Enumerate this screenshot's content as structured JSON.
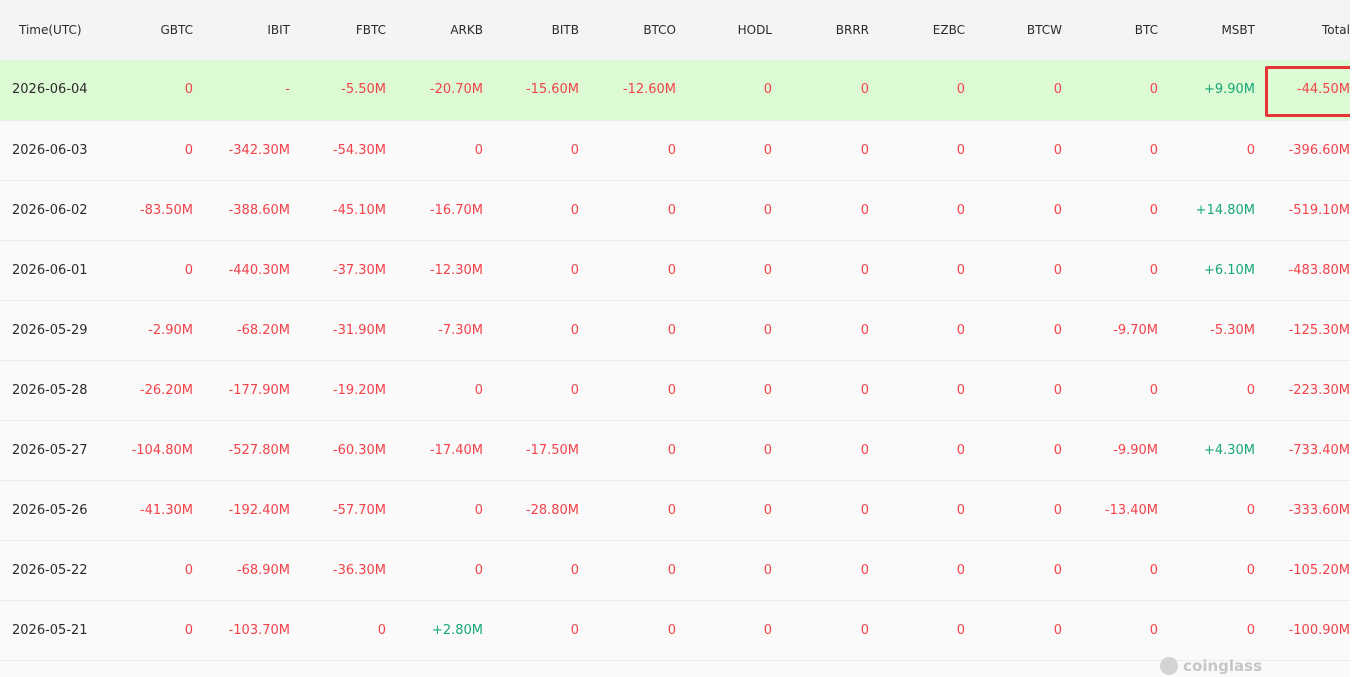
{
  "columns": [
    "Time(UTC)",
    "GBTC",
    "IBIT",
    "FBTC",
    "ARKB",
    "BITB",
    "BTCO",
    "HODL",
    "BRRR",
    "EZBC",
    "BTCW",
    "BTC",
    "MSBT",
    "Total"
  ],
  "rows": [
    [
      "2026-06-04",
      "0",
      "-",
      "-5.50M",
      "-20.70M",
      "-15.60M",
      "-12.60M",
      "0",
      "0",
      "0",
      "0",
      "0",
      "+9.90M",
      "-44.50M"
    ],
    [
      "2026-06-03",
      "0",
      "-342.30M",
      "-54.30M",
      "0",
      "0",
      "0",
      "0",
      "0",
      "0",
      "0",
      "0",
      "0",
      "-396.60M"
    ],
    [
      "2026-06-02",
      "-83.50M",
      "-388.60M",
      "-45.10M",
      "-16.70M",
      "0",
      "0",
      "0",
      "0",
      "0",
      "0",
      "0",
      "+14.80M",
      "-519.10M"
    ],
    [
      "2026-06-01",
      "0",
      "-440.30M",
      "-37.30M",
      "-12.30M",
      "0",
      "0",
      "0",
      "0",
      "0",
      "0",
      "0",
      "+6.10M",
      "-483.80M"
    ],
    [
      "2026-05-29",
      "-2.90M",
      "-68.20M",
      "-31.90M",
      "-7.30M",
      "0",
      "0",
      "0",
      "0",
      "0",
      "0",
      "-9.70M",
      "-5.30M",
      "-125.30M"
    ],
    [
      "2026-05-28",
      "-26.20M",
      "-177.90M",
      "-19.20M",
      "0",
      "0",
      "0",
      "0",
      "0",
      "0",
      "0",
      "0",
      "0",
      "-223.30M"
    ],
    [
      "2026-05-27",
      "-104.80M",
      "-527.80M",
      "-60.30M",
      "-17.40M",
      "-17.50M",
      "0",
      "0",
      "0",
      "0",
      "0",
      "-9.90M",
      "+4.30M",
      "-733.40M"
    ],
    [
      "2026-05-26",
      "-41.30M",
      "-192.40M",
      "-57.70M",
      "0",
      "-28.80M",
      "0",
      "0",
      "0",
      "0",
      "0",
      "-13.40M",
      "0",
      "-333.60M"
    ],
    [
      "2026-05-22",
      "0",
      "-68.90M",
      "-36.30M",
      "0",
      "0",
      "0",
      "0",
      "0",
      "0",
      "0",
      "0",
      "0",
      "-105.20M"
    ],
    [
      "2026-05-21",
      "0",
      "-103.70M",
      "0",
      "+2.80M",
      "0",
      "0",
      "0",
      "0",
      "0",
      "0",
      "0",
      "0",
      "-100.90M"
    ]
  ],
  "highlight_row": 0,
  "highlight_cell_column": 13,
  "watermark": "coinglass",
  "colors": {
    "negative": "#f2434b",
    "positive": "#18a77a",
    "highlight_row": "#dcfad3",
    "outline": "#e83434",
    "header_bg": "#f3f4f6"
  }
}
